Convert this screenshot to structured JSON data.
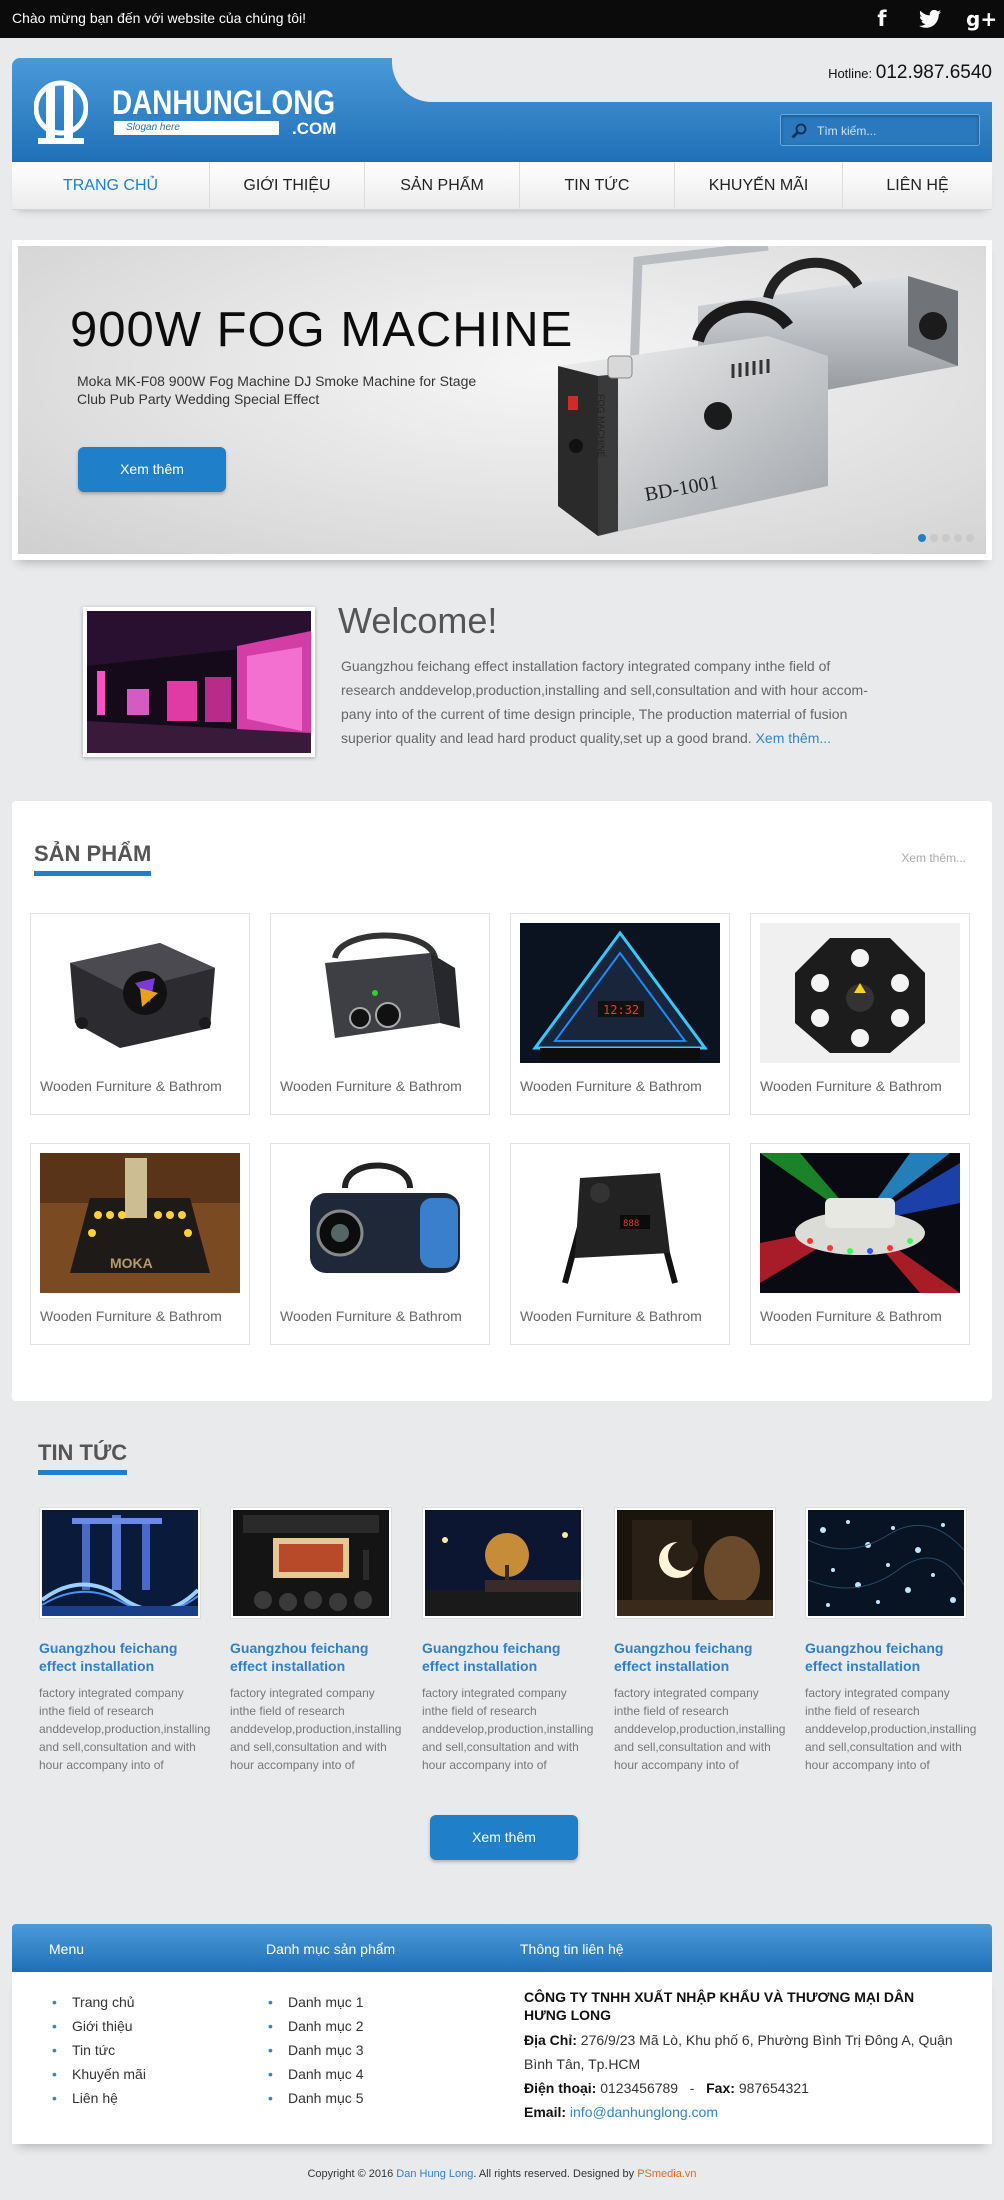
{
  "topbar": {
    "welcome": "Chào mừng bạn đến với website của chúng tôi!",
    "social": [
      {
        "icon": "facebook-icon",
        "glyph": "f"
      },
      {
        "icon": "twitter-icon",
        "glyph": "t"
      },
      {
        "icon": "google-plus-icon",
        "glyph": "g+"
      }
    ]
  },
  "header": {
    "hotline_label": "Hotline:",
    "hotline_number": "012.987.6540",
    "logo_name": "DANHUNGLONG",
    "logo_slogan": "Slogan here",
    "logo_suffix": ".COM",
    "search_placeholder": "Tìm kiếm..."
  },
  "nav": {
    "items": [
      {
        "label": "TRANG CHỦ",
        "active": true
      },
      {
        "label": "GIỚI THIỆU",
        "active": false
      },
      {
        "label": "SẢN PHẨM",
        "active": false
      },
      {
        "label": "TIN TỨC",
        "active": false
      },
      {
        "label": "KHUYẾN MÃI",
        "active": false
      },
      {
        "label": "LIÊN HỆ",
        "active": false
      }
    ]
  },
  "slider": {
    "title": "900W FOG MACHINE",
    "description": "Moka MK-F08 900W Fog Machine DJ Smoke Machine for Stage Club Pub Party Wedding Special Effect",
    "button": "Xem thêm",
    "machine_label": "BD-1001",
    "panel_label": "FOG MACHINE",
    "slides_count": 5,
    "active_slide": 1
  },
  "welcome": {
    "title": "Welcome!",
    "text": "Guangzhou feichang effect installation factory integrated company inthe field of research anddevelop,production,installing and sell,consultation and with hour accom-pany into of the current of time design principle, The production materrial of fusion superior quality and lead hard product quality,set up a good brand.",
    "more": "Xem thêm..."
  },
  "products": {
    "title": "SẢN PHẨM",
    "more": "Xem thêm...",
    "items": [
      {
        "name": "Wooden Furniture & Bathrom",
        "image": "moving-head-light"
      },
      {
        "name": "Wooden Furniture & Bathrom",
        "image": "laser-projector"
      },
      {
        "name": "Wooden Furniture & Bathrom",
        "image": "led-pyramid"
      },
      {
        "name": "Wooden Furniture & Bathrom",
        "image": "octagon-led-light"
      },
      {
        "name": "Wooden Furniture & Bathrom",
        "image": "co2-jet-machine"
      },
      {
        "name": "Wooden Furniture & Bathrom",
        "image": "effect-projector"
      },
      {
        "name": "Wooden Furniture & Bathrom",
        "image": "led-par-light"
      },
      {
        "name": "Wooden Furniture & Bathrom",
        "image": "ufo-led-light"
      }
    ]
  },
  "news": {
    "title": "TIN TỨC",
    "button": "Xem thêm",
    "items": [
      {
        "title": "Guangzhou feichang effect installation",
        "desc": "factory integrated company inthe field of research anddevelop,production,installing and sell,consultation and with hour accompany into of",
        "image": "night-bridge"
      },
      {
        "title": "Guangzhou feichang effect installation",
        "desc": "factory integrated company inthe field of research anddevelop,production,installing and sell,consultation and with hour accompany into of",
        "image": "conference-room"
      },
      {
        "title": "Guangzhou feichang effect installation",
        "desc": "factory integrated company inthe field of research anddevelop,production,installing and sell,consultation and with hour accompany into of",
        "image": "night-street"
      },
      {
        "title": "Guangzhou feichang effect installation",
        "desc": "factory integrated company inthe field of research anddevelop,production,installing and sell,consultation and with hour accompany into of",
        "image": "moon-lamp"
      },
      {
        "title": "Guangzhou feichang effect installation",
        "desc": "factory integrated company inthe field of research anddevelop,production,installing and sell,consultation and with hour accompany into of",
        "image": "string-lights"
      }
    ]
  },
  "footer": {
    "menu_title": "Menu",
    "menu": [
      "Trang chủ",
      "Giới thiệu",
      "Tin tức",
      "Khuyến mãi",
      "Liên hệ"
    ],
    "categories_title": "Danh mục sản phẩm",
    "categories": [
      "Danh mục 1",
      "Danh mục 2",
      "Danh mục 3",
      "Danh mục 4",
      "Danh mục 5"
    ],
    "contact_title": "Thông tin liên hệ",
    "company": "CÔNG TY TNHH XUẤT NHẬP KHẨU VÀ THƯƠNG MẠI DÂN HƯNG LONG",
    "address_label": "Địa Chỉ:",
    "address": "276/9/23 Mã Lò, Khu phố 6, Phường Bình Trị Đông A, Quận Bình Tân, Tp.HCM",
    "phone_label": "Điện thoại:",
    "phone": "0123456789",
    "separator": "-",
    "fax_label": "Fax:",
    "fax": "987654321",
    "email_label": "Email:",
    "email": "info@danhunglong.com"
  },
  "copyright": {
    "prefix": "Copyright © 2016",
    "brand": "Dan Hung Long",
    "middle": ". All rights reserved. Designed by",
    "designer": "PSmedia.vn"
  },
  "colors": {
    "accent": "#1f7fc9",
    "orange": "#e76a1e",
    "topbar": "#0b0b0b",
    "background": "#e9eaec"
  }
}
